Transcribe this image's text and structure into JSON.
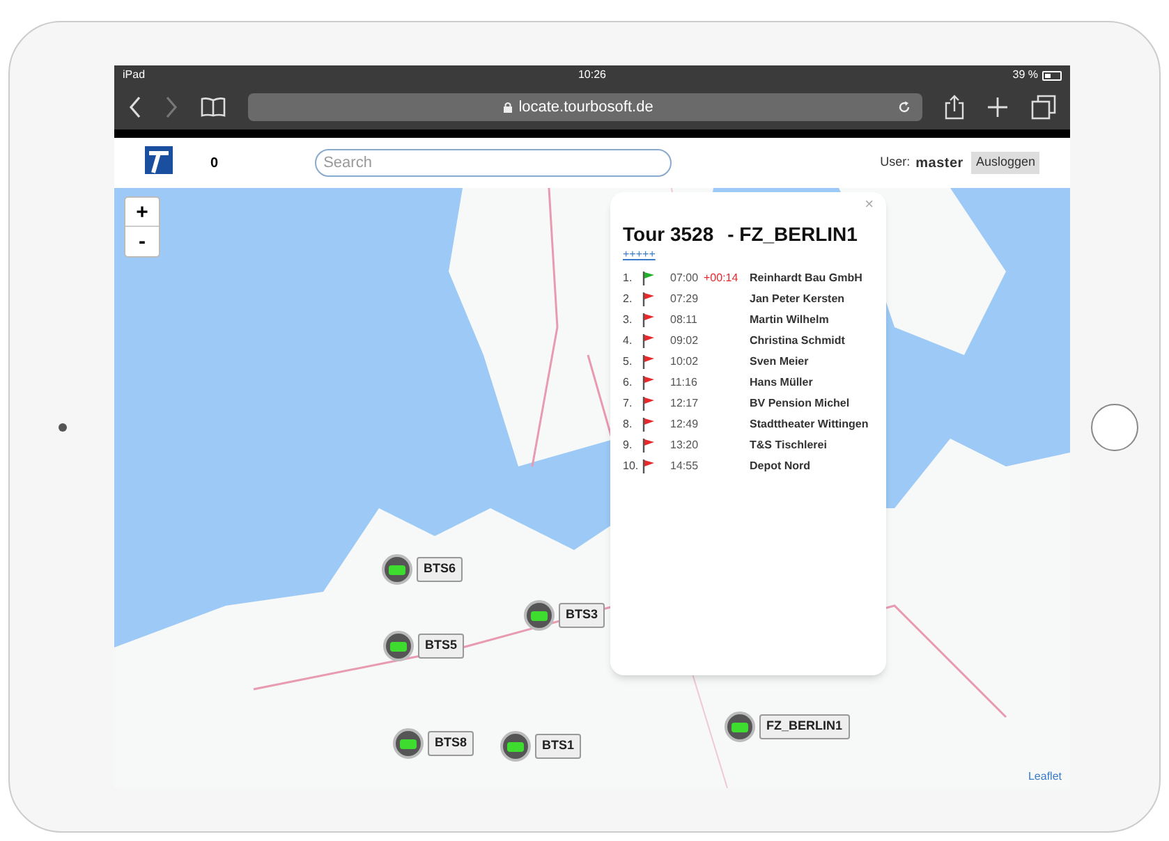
{
  "status_bar": {
    "device": "iPad",
    "time": "10:26",
    "battery": "39 %"
  },
  "browser": {
    "url": "locate.tourbosoft.de"
  },
  "header": {
    "count": "0",
    "search": {
      "placeholder": "Search"
    },
    "user_label": "User:",
    "user": "master",
    "logout": "Ausloggen"
  },
  "map": {
    "zoom_in": "+",
    "zoom_out": "-",
    "attribution": "Leaflet",
    "markers": [
      {
        "label": "BTS6"
      },
      {
        "label": "BTS3"
      },
      {
        "label": "BTS5"
      },
      {
        "label": "BTS8"
      },
      {
        "label": "BTS1"
      },
      {
        "label": "FZ_BERLIN1"
      }
    ]
  },
  "popup": {
    "close": "×",
    "tour": "Tour 3528",
    "vehicle": "- FZ_BERLIN1",
    "link": "+++++",
    "stops": [
      {
        "number": "1.",
        "color": "#22b02a",
        "time": "07:00",
        "delay": "+00:14",
        "name": "Reinhardt Bau GmbH"
      },
      {
        "number": "2.",
        "color": "#e8282b",
        "time": "07:29",
        "name": "Jan Peter Kersten"
      },
      {
        "number": "3.",
        "color": "#e8282b",
        "time": "08:11",
        "name": "Martin Wilhelm"
      },
      {
        "number": "4.",
        "color": "#e8282b",
        "time": "09:02",
        "name": "Christina Schmidt"
      },
      {
        "number": "5.",
        "color": "#e8282b",
        "time": "10:02",
        "name": "Sven Meier"
      },
      {
        "number": "6.",
        "color": "#e8282b",
        "time": "11:16",
        "name": "Hans Müller"
      },
      {
        "number": "7.",
        "color": "#e8282b",
        "time": "12:17",
        "name": "BV Pension Michel"
      },
      {
        "number": "8.",
        "color": "#e8282b",
        "time": "12:49",
        "name": "Stadttheater Wittingen"
      },
      {
        "number": "9.",
        "color": "#e8282b",
        "time": "13:20",
        "name": "T&S Tischlerei"
      },
      {
        "number": "10.",
        "color": "#e8282b",
        "time": "14:55",
        "name": "Depot Nord"
      }
    ]
  }
}
